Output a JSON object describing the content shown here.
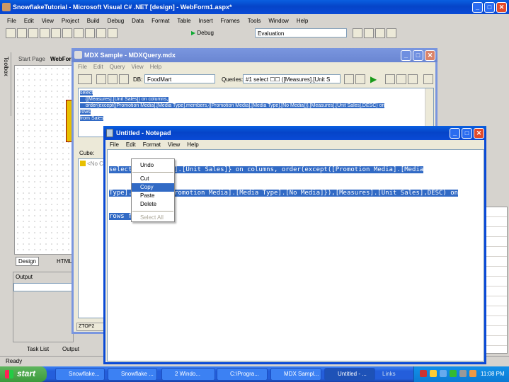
{
  "vs": {
    "title": "SnowflakeTutorial - Microsoft Visual C# .NET [design] - WebForm1.aspx*",
    "menu": [
      "File",
      "Edit",
      "View",
      "Project",
      "Build",
      "Debug",
      "Data",
      "Format",
      "Table",
      "Insert",
      "Frames",
      "Tools",
      "Window",
      "Help"
    ],
    "config_combo": "Debug",
    "solution_combo": "Evaluation",
    "toolbox_label": "Toolbox",
    "tabs": [
      "Start Page",
      "WebForm"
    ],
    "design_tab": "Design",
    "html_tab": "HTML",
    "output_title": "Output",
    "task_list_tab": "Task List",
    "output_tab": "Output",
    "status": "Ready"
  },
  "mdx": {
    "title": "MDX Sample - MDXQuery.mdx",
    "menu": [
      "File",
      "Edit",
      "Query",
      "View",
      "Help"
    ],
    "db_label": "DB:",
    "db_value": "FoodMart",
    "queries_label": "Queries:",
    "queries_value": "#1 select ☐☐   ([Measures].[Unit S",
    "query_lines": [
      "select",
      "    {[Measures].[Unit Sales]} on columns,",
      "    order(except([Promotion Media].[Media Type].members,{[Promotion Media].[Media Type].[No Media]}),[Measures].[Unit Sales],DESC) on",
      "rows",
      "from Sales"
    ],
    "cube_label": "Cube:",
    "tree_item": "<No C",
    "status_item": "ZTOP2"
  },
  "notepad": {
    "title": "Untitled - Notepad",
    "menu": [
      "File",
      "Edit",
      "Format",
      "View",
      "Help"
    ],
    "lines": [
      "select {[Measures].[Unit Sales]} on columns, order(except([Promotion Media].[Media",
      "Type].m     s,{[Promotion Media].[Media Type].[No Media]}),[Measures].[Unit Sales],DESC) on",
      "rows f"
    ]
  },
  "context_menu": {
    "items": [
      {
        "label": "Undo",
        "enabled": true
      },
      {
        "label": "Cut",
        "enabled": true
      },
      {
        "label": "Copy",
        "enabled": true,
        "selected": true
      },
      {
        "label": "Paste",
        "enabled": true
      },
      {
        "label": "Delete",
        "enabled": true
      },
      {
        "label": "Select All",
        "enabled": false
      }
    ]
  },
  "taskbar": {
    "start": "start",
    "tasks": [
      "Snowflake...",
      "Snowflake ...",
      "2 Windo...",
      "C:\\Progra...",
      "MDX Sampl...",
      "Untitled - ..."
    ],
    "links": "Links",
    "clock": "11:08 PM"
  },
  "colors": {
    "selection": "#316ac5",
    "title_blue": "#0a4ad6",
    "taskbar": "#245edb",
    "start": "#3c9a3c"
  }
}
